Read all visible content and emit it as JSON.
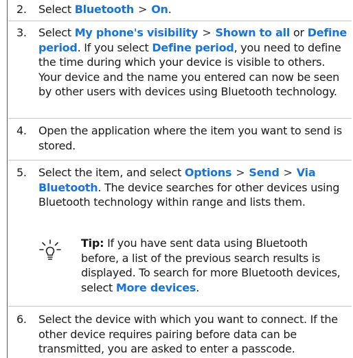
{
  "step2": {
    "num": "2.",
    "pre": "Select ",
    "bluetooth": "Bluetooth",
    "sep": ">",
    "on": "On",
    "post": "."
  },
  "step3": {
    "num": "3.",
    "pre": "Select ",
    "visibility": "My phone's visibility",
    "sep": ">",
    "shown": "Shown to all",
    "or": " or ",
    "define": "Define period",
    "mid": ". If you select ",
    "define2": "Define period",
    "rest": ", you need to define the time during which your device is visible to others. Your device and the name you entered can now be seen by other users with devices using Bluetooth technology."
  },
  "step4": {
    "num": "4.",
    "text": "Open the application where the item you want to send is stored."
  },
  "step5": {
    "num": "5.",
    "pre": "Select the item, and select ",
    "options": "Options",
    "sep1": ">",
    "send": "Send",
    "sep2": ">",
    "via": "Via Bluetooth",
    "rest": ". The device searches for other devices using Bluetooth technology within range and lists them."
  },
  "tip": {
    "label": "Tip:",
    "text": " If you have sent data using Bluetooth before, a list of the previous search results is displayed. To search for more Bluetooth devices, select ",
    "more": "More devices",
    "end": "."
  },
  "step6": {
    "num": "6.",
    "text": "Select the device with which you want to connect. If the other device requires pairing before data can be transmitted, you are asked to enter a passcode."
  },
  "colors": {
    "link": "#1a73d6",
    "rule": "#c8c8c8",
    "bar": "#555555"
  },
  "icons": {
    "tip": "lightbulb-icon"
  }
}
